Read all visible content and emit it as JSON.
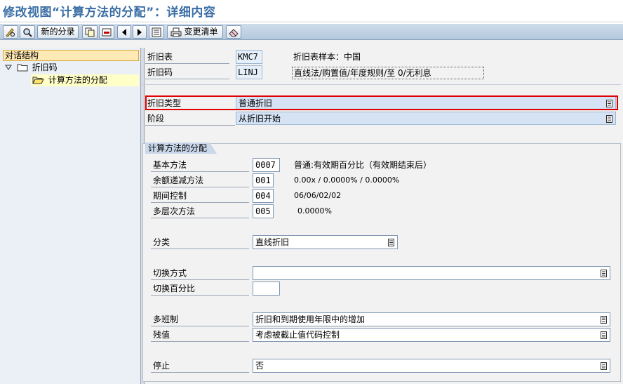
{
  "window": {
    "title": "修改视图“计算方法的分配”：详细内容"
  },
  "toolbar": {
    "new_entries": "新的分录",
    "change_request": "变更清单"
  },
  "tree": {
    "header": "对话结构",
    "items": [
      {
        "label": "折旧码"
      },
      {
        "label": "计算方法的分配"
      }
    ]
  },
  "header_fields": {
    "chart": {
      "label": "折旧表",
      "value": "KMC7",
      "desc": "折旧表样本：中国"
    },
    "key": {
      "label": "折旧码",
      "value": "LINJ",
      "desc": "直线法/购置值/年度规则/至 0/无利息"
    }
  },
  "type_fields": {
    "dep_type": {
      "label": "折旧类型",
      "value": "普通折旧"
    },
    "phase": {
      "label": "阶段",
      "value": "从折旧开始"
    }
  },
  "group": {
    "title": "计算方法的分配",
    "rows": [
      {
        "label": "基本方法",
        "value": "0007",
        "desc": "普通:有效期百分比（有效期结束后）"
      },
      {
        "label": "余额递减方法",
        "value": "001",
        "desc": "0.00x / 0.0000% / 0.0000%"
      },
      {
        "label": "期间控制",
        "value": "004",
        "desc": "06/06/02/02"
      },
      {
        "label": "多层次方法",
        "value": "005",
        "desc": "0.0000%"
      }
    ],
    "class": {
      "label": "分类",
      "value": "直线折旧"
    },
    "switch_method": {
      "label": "切换方式",
      "value": ""
    },
    "switch_pct": {
      "label": "切换百分比",
      "value": ""
    },
    "multi_shift": {
      "label": "多班制",
      "value": "折旧和到期使用年限中的增加"
    },
    "scrap": {
      "label": "残值",
      "value": "考虑被截止值代码控制"
    },
    "stop": {
      "label": "停止",
      "value": "否"
    }
  }
}
